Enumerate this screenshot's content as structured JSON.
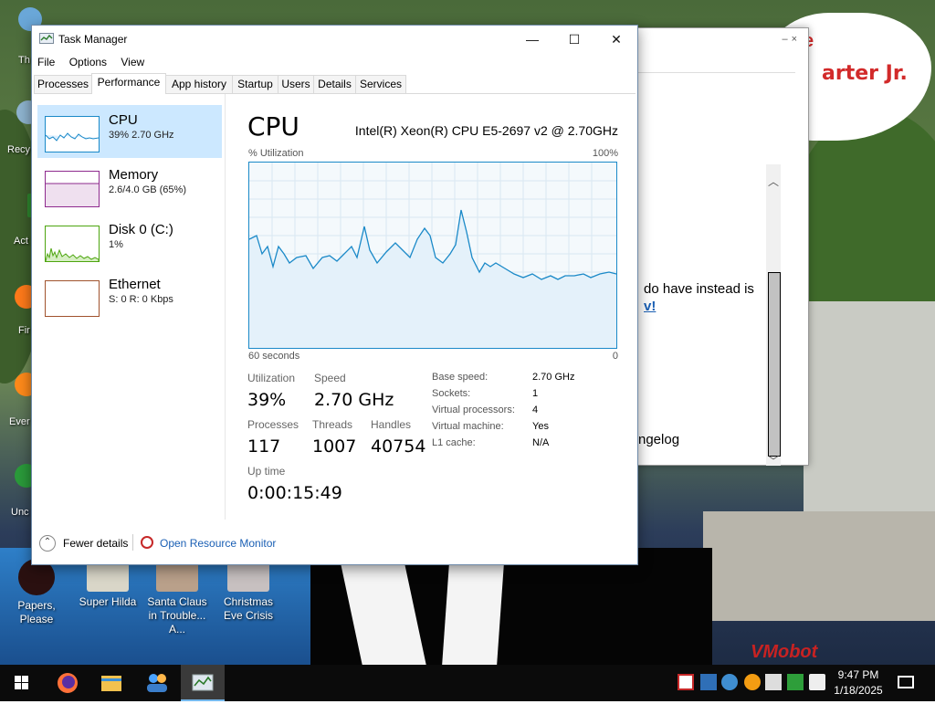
{
  "desktop": {
    "icons": [
      {
        "label": "Papers, Please"
      },
      {
        "label": "Super Hilda"
      },
      {
        "label": "Santa Claus in Trouble... A..."
      },
      {
        "label": "Christmas Eve Crisis"
      }
    ],
    "edge_labels": [
      "Th",
      "Recy",
      "Act",
      "Fir",
      "Ever",
      "Unc"
    ],
    "bubble_text": "arter Jr.",
    "bubble_text_top": "e",
    "watermark": "VMobot"
  },
  "background_window": {
    "text1": "do have instead is",
    "text2": "v!",
    "text3": "ngelog"
  },
  "task_manager": {
    "title": "Task Manager",
    "menu": [
      "File",
      "Options",
      "View"
    ],
    "tabs": [
      "Processes",
      "Performance",
      "App history",
      "Startup",
      "Users",
      "Details",
      "Services"
    ],
    "active_tab": "Performance",
    "resources": [
      {
        "name": "CPU",
        "sub": "39%  2.70 GHz",
        "color": "#1a89c8",
        "selected": true
      },
      {
        "name": "Memory",
        "sub": "2.6/4.0 GB (65%)",
        "color": "#8e2a8e",
        "selected": false
      },
      {
        "name": "Disk 0 (C:)",
        "sub": "1%",
        "color": "#4da50f",
        "selected": false
      },
      {
        "name": "Ethernet",
        "sub": "S: 0  R: 0 Kbps",
        "color": "#a0522d",
        "selected": false
      }
    ],
    "cpu": {
      "title": "CPU",
      "model": "Intel(R) Xeon(R) CPU E5-2697 v2 @ 2.70GHz",
      "util_label": "% Utilization",
      "util_max": "100%",
      "time_left": "60 seconds",
      "time_right": "0",
      "utilization_label": "Utilization",
      "utilization": "39%",
      "speed_label": "Speed",
      "speed": "2.70 GHz",
      "processes_label": "Processes",
      "processes": "117",
      "threads_label": "Threads",
      "threads": "1007",
      "handles_label": "Handles",
      "handles": "40754",
      "uptime_label": "Up time",
      "uptime": "0:00:15:49",
      "details": [
        {
          "key": "Base speed:",
          "value": "2.70 GHz"
        },
        {
          "key": "Sockets:",
          "value": "1"
        },
        {
          "key": "Virtual processors:",
          "value": "4"
        },
        {
          "key": "Virtual machine:",
          "value": "Yes"
        },
        {
          "key": "L1 cache:",
          "value": "N/A"
        }
      ]
    },
    "footer": {
      "fewer_details": "Fewer details",
      "open_resource_monitor": "Open Resource Monitor"
    }
  },
  "taskbar": {
    "apps": [
      "start-icon",
      "firefox-icon",
      "file-explorer-icon",
      "people-icon",
      "task-manager-icon"
    ],
    "clock_time": "9:47 PM",
    "clock_date": "1/18/2025"
  }
}
